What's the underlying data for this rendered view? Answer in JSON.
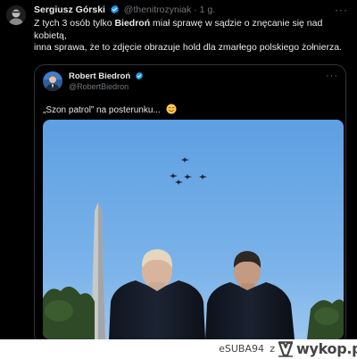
{
  "post": {
    "author_name": "Sergiusz Górski",
    "handle": "@thenitrozyniak",
    "separator": "·",
    "time": "1 g.",
    "text_before_bold": "Z tych 3 osób tylko ",
    "text_bold": "Biedroń",
    "text_after_bold": " miał sprawę w sądzie o znęcanie się nad kobietą,",
    "text_line2": "inna sprawa, że to zdjęcie obrazuje hold dla zmarłego polskiego żołnierza.",
    "more_label": "···"
  },
  "quoted": {
    "author_name": "Robert Biedroń",
    "handle": "@RobertBiedron",
    "text": "„Szon patrol” na posterunku...",
    "more_label": "···"
  },
  "watermark": {
    "username": "eSUBA94",
    "connector": "z",
    "logo_text": "wykop.pl"
  },
  "colors": {
    "background": "#000000",
    "verified_badge": "#1d9bf0",
    "text_primary": "#e7e9ea",
    "text_secondary": "#71767b",
    "quote_border": "#2f3336",
    "sky": "#5fa0e0"
  },
  "icons": {
    "verified": "verified-badge-icon",
    "smile": "smiling-face-emoji-icon",
    "more": "more-options-icon",
    "logo": "wykop-logo-icon"
  }
}
